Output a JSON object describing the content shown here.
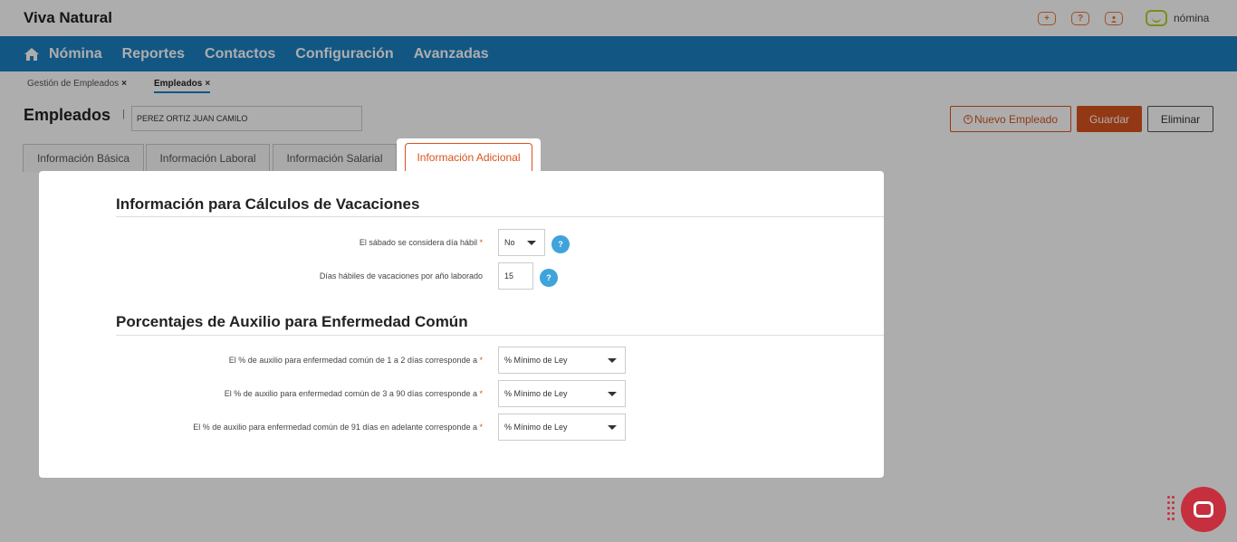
{
  "app": {
    "company": "Viva Natural",
    "brand": "nómina",
    "top_icons": [
      "plus-icon",
      "help-icon",
      "user-icon"
    ]
  },
  "nav": {
    "items": [
      "Nómina",
      "Reportes",
      "Contactos",
      "Configuración",
      "Avanzadas"
    ],
    "color": "#1b81c3"
  },
  "breadcrumbs": [
    {
      "label": "Gestión de Empleados",
      "close": "×"
    },
    {
      "label": "Empleados",
      "close": "×"
    }
  ],
  "page": {
    "title": "Empleados",
    "separator": "|",
    "employee_name": "PEREZ ORTIZ JUAN CAMILO"
  },
  "buttons": {
    "new": "Nuevo Empleado",
    "save": "Guardar",
    "delete": "Eliminar",
    "accent": "#d9531e"
  },
  "tabs": [
    "Información Básica",
    "Información Laboral",
    "Información Salarial",
    "Información Adicional"
  ],
  "active_tab": "Información Adicional",
  "vacations": {
    "title": "Información para Cálculos de Vacaciones",
    "saturday_label": "El sábado se considera día hábil",
    "saturday_value": "No",
    "days_label": "Días hábiles de vacaciones por año laborado",
    "days_value": "15"
  },
  "sickness": {
    "title": "Porcentajes de Auxilio para Enfermedad Común",
    "rows": [
      {
        "label": "El % de auxilio para enfermedad común de 1 a 2 días corresponde a",
        "value": "% Mínimo de Ley"
      },
      {
        "label": "El % de auxilio para enfermedad común de 3 a 90 días corresponde a",
        "value": "% Mínimo de Ley"
      },
      {
        "label": "El % de auxilio para enfermedad común de 91 días en adelante corresponde a",
        "value": "% Mínimo de Ley"
      }
    ]
  },
  "required_mark": "*",
  "help_glyph": "?"
}
